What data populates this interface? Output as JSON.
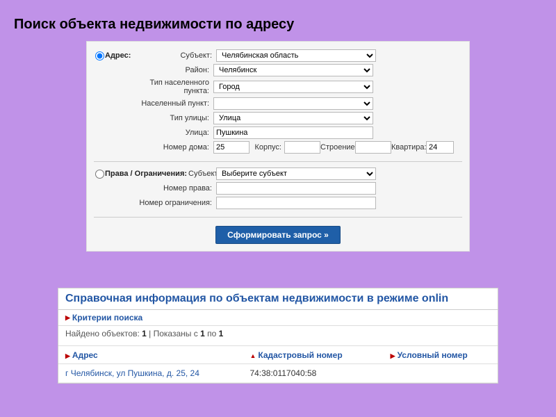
{
  "title": "Поиск объекта недвижимости по адресу",
  "form": {
    "address_section_label": "Адрес:",
    "rights_section_label": "Права / Ограничения:",
    "labels": {
      "subject": "Субъект:",
      "district": "Район:",
      "settlement_type": "Тип населенного пункта:",
      "settlement": "Населенный пункт:",
      "street_type": "Тип улицы:",
      "street": "Улица:",
      "house_no": "Номер дома:",
      "korpus": "Корпус:",
      "stroenie": "Строение:",
      "apartment": "Квартира:",
      "rights_subject": "Субъект:",
      "rights_no": "Номер права:",
      "restriction_no": "Номер ограничения:"
    },
    "values": {
      "subject": "Челябинская область",
      "district": "Челябинск",
      "settlement_type": "Город",
      "settlement": "",
      "street_type": "Улица",
      "street": "Пушкина",
      "house_no": "25",
      "korpus": "",
      "stroenie": "",
      "apartment": "24",
      "rights_subject": "Выберите субъект",
      "rights_no": "",
      "restriction_no": ""
    },
    "submit": "Сформировать запрос »"
  },
  "results": {
    "heading": "Справочная информация по объектам недвижимости в режиме onlin",
    "criteria_label": "Критерии поиска",
    "found_prefix": "Найдено объектов: ",
    "found_count": "1",
    "shown_sep": " | Показаны с ",
    "shown_from": "1",
    "shown_mid": " по ",
    "shown_to": "1",
    "columns": {
      "address": "Адрес",
      "cadastre": "Кадастровый номер",
      "conditional": "Условный номер"
    },
    "row": {
      "address": "г Челябинск, ул Пушкина, д. 25, 24",
      "cadastre": "74:38:0117040:58",
      "conditional": ""
    }
  }
}
